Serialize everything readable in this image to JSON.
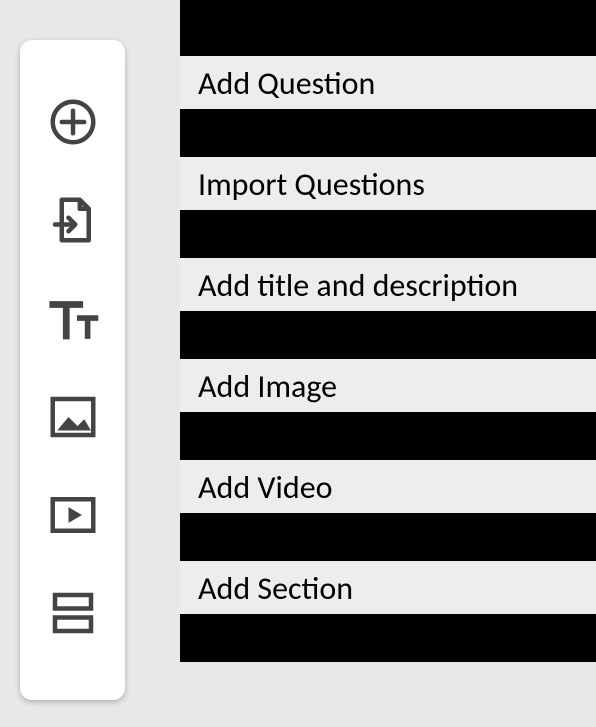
{
  "toolbar": {
    "items": [
      {
        "label": "Add Question"
      },
      {
        "label": "Import Questions"
      },
      {
        "label": "Add title and description"
      },
      {
        "label": "Add Image"
      },
      {
        "label": "Add Video"
      },
      {
        "label": "Add Section"
      }
    ]
  }
}
